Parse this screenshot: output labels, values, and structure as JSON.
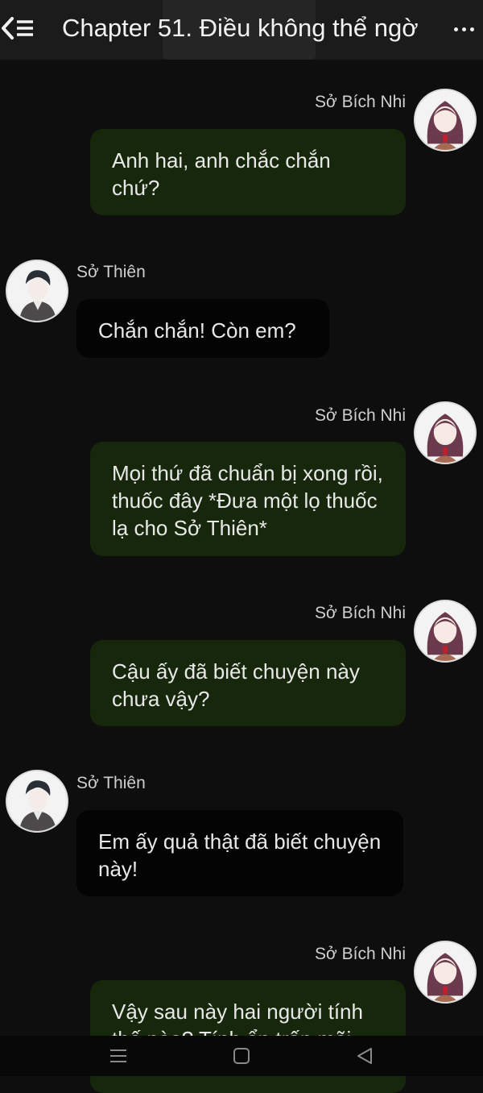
{
  "header": {
    "title": "Chapter 51. Điều không thể ngờ",
    "back_icon": "back-list-icon",
    "more_icon": "more-dots-icon"
  },
  "messages": [
    {
      "sender": "Sở Bích Nhi",
      "side": "right",
      "text": "Anh hai, anh chắc chắn chứ?"
    },
    {
      "sender": "Sở Thiên",
      "side": "left",
      "text": "Chắn chắn! Còn em?"
    },
    {
      "sender": "Sở Bích Nhi",
      "side": "right",
      "text": "Mọi thứ đã chuẩn bị xong rồi, thuốc đây *Đưa một lọ thuốc lạ cho Sở Thiên*"
    },
    {
      "sender": "Sở Bích Nhi",
      "side": "right",
      "text": "Cậu ấy đã biết chuyện này chưa vậy?"
    },
    {
      "sender": "Sở Thiên",
      "side": "left",
      "text": "Em ấy quả thật đã biết chuyện này!"
    },
    {
      "sender": "Sở Bích Nhi",
      "side": "right",
      "text": "Vậy sau này hai người tính thế nào? Tính ẩn trốn mãi"
    }
  ],
  "navbar": {
    "menu_icon": "menu-icon",
    "home_icon": "home-square-icon",
    "back_icon": "back-triangle-icon"
  },
  "colors": {
    "background": "#0e0e0e",
    "header": "#1b1b1b",
    "bubble_right": "#17270b",
    "bubble_left": "#040404",
    "text": "#e8e8e8"
  }
}
